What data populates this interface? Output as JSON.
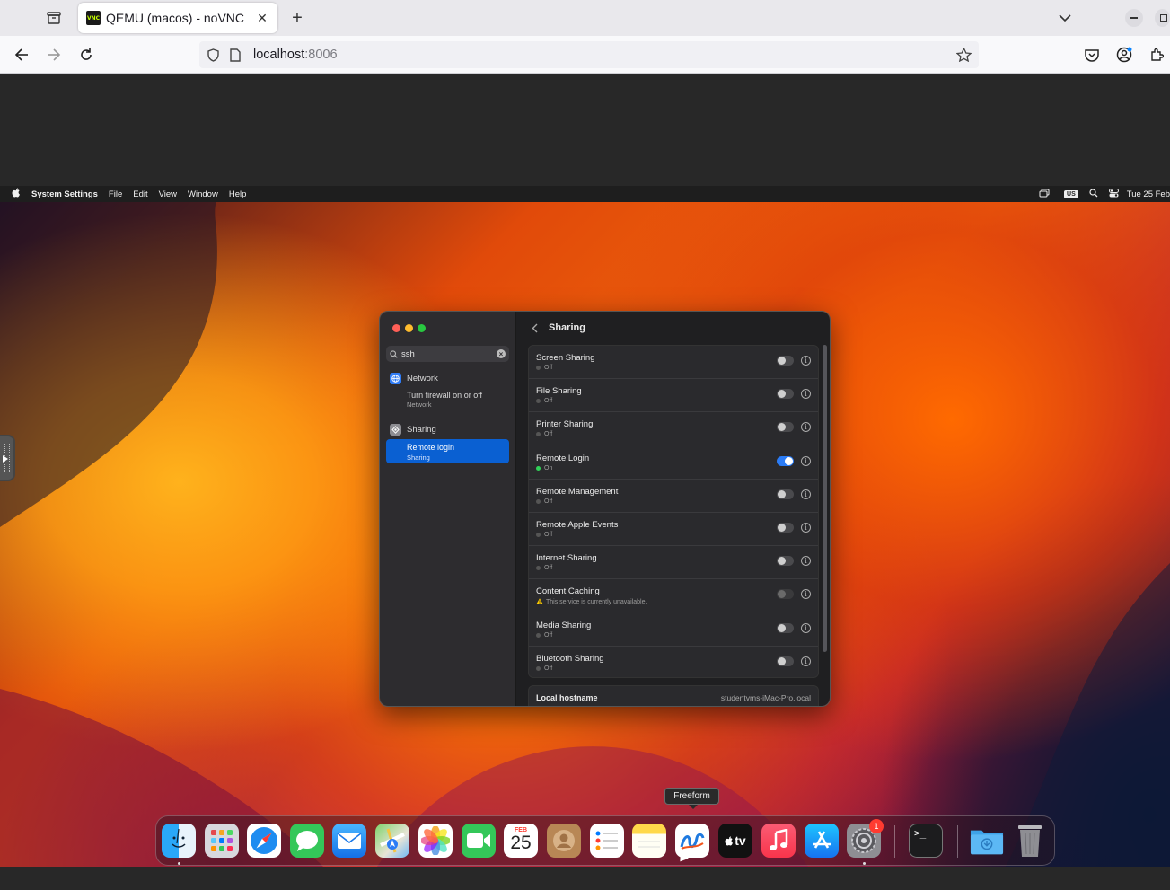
{
  "browser": {
    "tab_title": "QEMU (macos) - noVNC",
    "favicon_text": "VNC",
    "url_host": "localhost",
    "url_port": ":8006"
  },
  "menubar": {
    "app_name": "System Settings",
    "items": [
      "File",
      "Edit",
      "View",
      "Window",
      "Help"
    ],
    "keyboard_layout": "US",
    "clock": "Tue 25 Feb"
  },
  "settings": {
    "search_value": "ssh",
    "sidebar": {
      "groups": [
        {
          "label": "Network",
          "sub_title": "Turn firewall on or off",
          "sub_caption": "Network"
        },
        {
          "label": "Sharing",
          "sub_title": "Remote login",
          "sub_caption": "Sharing"
        }
      ]
    },
    "page_title": "Sharing",
    "services": [
      {
        "name": "Screen Sharing",
        "status": "Off",
        "state": "off"
      },
      {
        "name": "File Sharing",
        "status": "Off",
        "state": "off"
      },
      {
        "name": "Printer Sharing",
        "status": "Off",
        "state": "off"
      },
      {
        "name": "Remote Login",
        "status": "On",
        "state": "on"
      },
      {
        "name": "Remote Management",
        "status": "Off",
        "state": "off"
      },
      {
        "name": "Remote Apple Events",
        "status": "Off",
        "state": "off"
      },
      {
        "name": "Internet Sharing",
        "status": "Off",
        "state": "off"
      },
      {
        "name": "Content Caching",
        "status": "This service is currently unavailable.",
        "state": "disabled"
      },
      {
        "name": "Media Sharing",
        "status": "Off",
        "state": "off"
      },
      {
        "name": "Bluetooth Sharing",
        "status": "Off",
        "state": "off"
      }
    ],
    "hostname_label": "Local hostname",
    "hostname_value": "studentvms-iMac-Pro.local"
  },
  "dock": {
    "tooltip": "Freeform",
    "calendar_month": "FEB",
    "calendar_day": "25",
    "tv_label": "tv",
    "settings_badge": "1",
    "apps": [
      "finder",
      "launchpad",
      "safari",
      "messages",
      "mail",
      "maps",
      "photos",
      "facetime",
      "calendar",
      "contacts",
      "reminders",
      "notes",
      "freeform",
      "apple-tv",
      "music",
      "app-store",
      "system-settings",
      "terminal",
      "downloads",
      "trash"
    ]
  },
  "colors": {
    "accent": "#0a60d2",
    "toggle_on": "#2b7cf6",
    "status_on": "#30d158"
  }
}
